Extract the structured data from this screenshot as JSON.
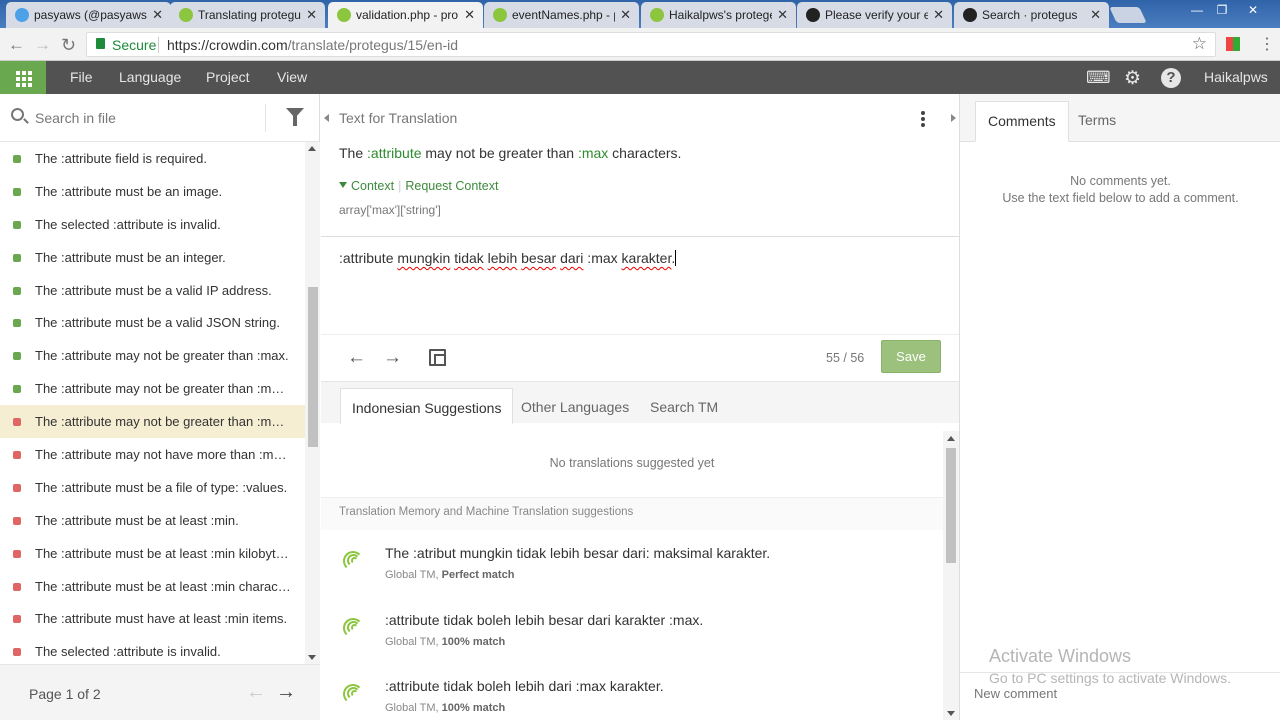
{
  "browser": {
    "tabs": [
      {
        "title": "pasyaws (@pasyaws",
        "fav": "#4da1e8"
      },
      {
        "title": "Translating protegu",
        "fav": "#8cc63f"
      },
      {
        "title": "validation.php - pro",
        "fav": "#8cc63f",
        "active": true
      },
      {
        "title": "eventNames.php - p",
        "fav": "#8cc63f"
      },
      {
        "title": "Haikalpws's protege",
        "fav": "#8cc63f"
      },
      {
        "title": "Please verify your e",
        "fav": "#222222"
      },
      {
        "title": "Search · protegus",
        "fav": "#222222"
      }
    ],
    "close_glyph": "✕",
    "secure_label": "Secure",
    "url_host": "https://crowdin.com",
    "url_path": "/translate/protegus/15/en-id"
  },
  "appbar": {
    "menu": [
      "File",
      "Language",
      "Project",
      "View"
    ],
    "user": "Haikalpws"
  },
  "left": {
    "search_placeholder": "Search in file",
    "strings": [
      {
        "text": "The :attribute field is required.",
        "status": "translated"
      },
      {
        "text": "The :attribute must be an image.",
        "status": "translated"
      },
      {
        "text": "The selected :attribute is invalid.",
        "status": "translated"
      },
      {
        "text": "The :attribute must be an integer.",
        "status": "translated"
      },
      {
        "text": "The :attribute must be a valid IP address.",
        "status": "translated"
      },
      {
        "text": "The :attribute must be a valid JSON string.",
        "status": "translated"
      },
      {
        "text": "The :attribute may not be greater than :max.",
        "status": "translated"
      },
      {
        "text": "The :attribute may not be greater than :ma…",
        "status": "translated"
      },
      {
        "text": "The :attribute may not be greater than :ma…",
        "status": "untranslated",
        "selected": true
      },
      {
        "text": "The :attribute may not have more than :ma…",
        "status": "untranslated"
      },
      {
        "text": "The :attribute must be a file of type: :values.",
        "status": "untranslated"
      },
      {
        "text": "The :attribute must be at least :min.",
        "status": "untranslated"
      },
      {
        "text": "The :attribute must be at least :min kilobytes.",
        "status": "untranslated"
      },
      {
        "text": "The :attribute must be at least :min charact…",
        "status": "untranslated"
      },
      {
        "text": "The :attribute must have at least :min items.",
        "status": "untranslated"
      },
      {
        "text": "The selected :attribute is invalid.",
        "status": "untranslated"
      }
    ],
    "page_label": "Page 1 of 2"
  },
  "center": {
    "header": "Text for Translation",
    "source": {
      "p1": "The ",
      "v1": ":attribute",
      "p2": " may not be greater than ",
      "v2": ":max",
      "p3": " characters."
    },
    "context_label": "Context",
    "request_context": "Request Context",
    "context_value": "array['max']['string']",
    "translation": {
      "t1": ":attribute ",
      "w1": "mungkin",
      "s1": " ",
      "w2": "tidak",
      "s2": " ",
      "w3": "lebih",
      "s3": " ",
      "w4": "besar",
      "s4": " ",
      "w5": "dari",
      "t2": " :max ",
      "w6": "karakter",
      "t3": "."
    },
    "counter": "55 / 56",
    "save_label": "Save",
    "sug_tabs": [
      "Indonesian Suggestions",
      "Other Languages",
      "Search TM"
    ],
    "no_suggestions": "No translations suggested yet",
    "tm_header": "Translation Memory and Machine Translation suggestions",
    "tm_items": [
      {
        "text": "The :atribut mungkin tidak lebih besar dari: maksimal karakter.",
        "source": "Global TM,",
        "match": "Perfect match"
      },
      {
        "text": ":attribute tidak boleh lebih besar dari karakter :max.",
        "source": "Global TM,",
        "match": "100% match"
      },
      {
        "text": ":attribute tidak boleh lebih dari :max karakter.",
        "source": "Global TM,",
        "match": "100% match"
      }
    ]
  },
  "right": {
    "tabs": [
      "Comments",
      "Terms"
    ],
    "no_comments_1": "No comments yet.",
    "no_comments_2": "Use the text field below to add a comment.",
    "activate_title": "Activate Windows",
    "activate_sub": "Go to PC settings to activate Windows.",
    "new_comment": "New comment"
  },
  "colors": {
    "translated": "#6aa84f",
    "untranslated": "#e06666",
    "accent": "#8cc63f"
  }
}
